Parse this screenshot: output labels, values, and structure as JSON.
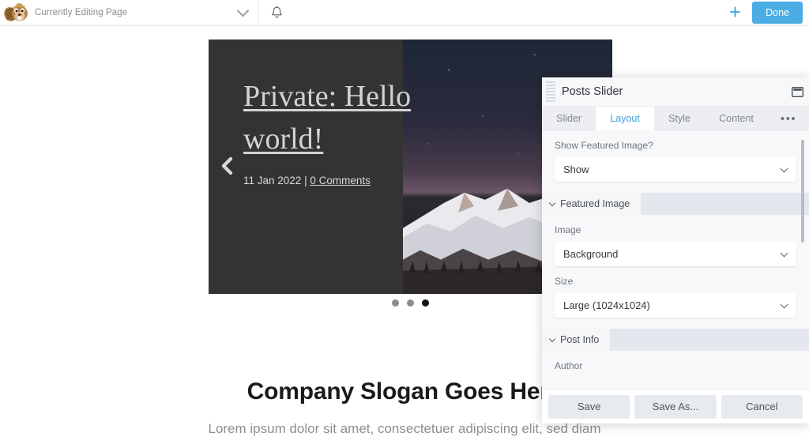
{
  "adminbar": {
    "logo_icon": "beaver-logo-icon",
    "title": "Currently Editing Page",
    "dropdown_icon": "chevron-down-icon",
    "bell_icon": "bell-icon",
    "plus_icon": "plus-icon",
    "plus_label": "+",
    "done_label": "Done",
    "accent_color": "#4cade4"
  },
  "content": {
    "slider": {
      "post_title": "Private: Hello world!",
      "post_date": "11 Jan 2022",
      "meta_separator": " | ",
      "comments_label": "0 Comments",
      "prev_icon": "chevron-left-icon",
      "dots": [
        {
          "active": false
        },
        {
          "active": false
        },
        {
          "active": true
        }
      ],
      "background_color": "#333333"
    },
    "slogan": "Company Slogan Goes Here",
    "subtext": "Lorem ipsum dolor sit amet, consectetuer adipiscing elit, sed diam"
  },
  "panel": {
    "title": "Posts Slider",
    "drag_handle_icon": "drag-handle-icon",
    "window_icon": "window-dock-icon",
    "tabs": [
      {
        "label": "Slider",
        "active": false
      },
      {
        "label": "Layout",
        "active": true
      },
      {
        "label": "Style",
        "active": false
      },
      {
        "label": "Content",
        "active": false
      }
    ],
    "more_label": "•••",
    "fields": [
      {
        "label": "Show Featured Image?",
        "value": "Show"
      }
    ],
    "sections": [
      {
        "name": "Featured Image",
        "fields": [
          {
            "label": "Image",
            "value": "Background"
          },
          {
            "label": "Size",
            "value": "Large (1024x1024)"
          }
        ]
      },
      {
        "name": "Post Info",
        "fields": [
          {
            "label": "Author",
            "value": ""
          }
        ]
      }
    ],
    "footer": {
      "save_label": "Save",
      "save_as_label": "Save As...",
      "cancel_label": "Cancel"
    },
    "active_tab_color": "#3ca4e2"
  }
}
